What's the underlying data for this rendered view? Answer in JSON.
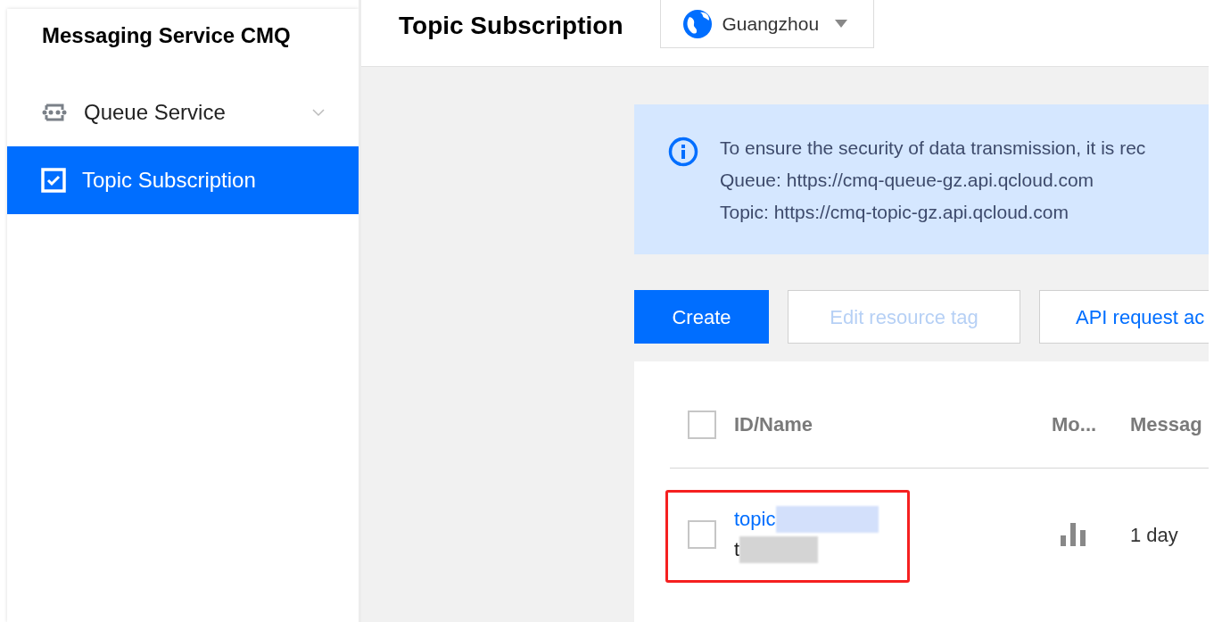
{
  "sidebar": {
    "title": "Messaging Service CMQ",
    "items": [
      {
        "label": "Queue Service",
        "kind": "queue",
        "selected": false,
        "expanded": false
      },
      {
        "label": "Topic Subscription",
        "kind": "topic",
        "selected": true
      }
    ]
  },
  "header": {
    "title": "Topic Subscription",
    "region": "Guangzhou"
  },
  "notice": {
    "lines": [
      "To ensure the security of data transmission, it is rec",
      "Queue: https://cmq-queue-gz.api.qcloud.com",
      "Topic: https://cmq-topic-gz.api.qcloud.com"
    ]
  },
  "buttons": [
    {
      "label": "Create",
      "kind": "primary",
      "disabled": false
    },
    {
      "label": "Edit resource tag",
      "kind": "default",
      "disabled": true
    },
    {
      "label": "API request ac",
      "kind": "default",
      "disabled": false
    }
  ],
  "table": {
    "select_all": {
      "checked": false
    },
    "columns": [
      "ID/Name",
      "Mo...",
      "Messag"
    ],
    "rows": [
      {
        "checked": false,
        "id": "topic",
        "name": "t",
        "retention": "1 day",
        "highlighted": true
      }
    ]
  }
}
